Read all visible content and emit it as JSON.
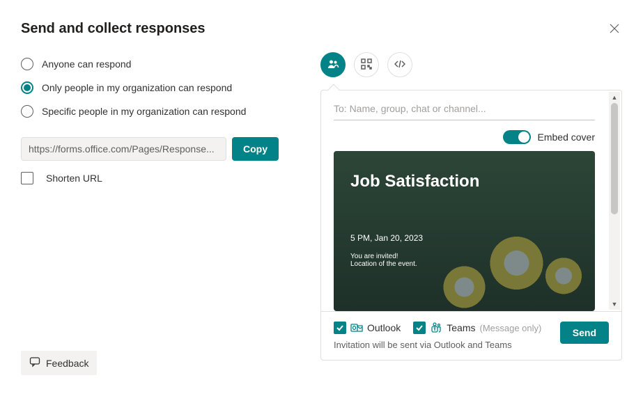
{
  "title": "Send and collect responses",
  "radios": {
    "opt0": "Anyone can respond",
    "opt1": "Only people in my organization can respond",
    "opt2": "Specific people in my organization can respond",
    "selected": 1
  },
  "url": {
    "value": "https://forms.office.com/Pages/Response...",
    "copy_label": "Copy"
  },
  "shorten": {
    "label": "Shorten URL",
    "checked": false
  },
  "feedback_label": "Feedback",
  "tabs": {
    "active": 0
  },
  "invite": {
    "to_placeholder": "To: Name, group, chat or channel...",
    "embed_label": "Embed cover",
    "embed_on": true
  },
  "cover": {
    "title": "Job Satisfaction",
    "time": "5 PM, Jan 20, 2023",
    "line1": "You are invited!",
    "line2": "Location of the event."
  },
  "footer": {
    "outlook_label": "Outlook",
    "outlook_checked": true,
    "teams_label": "Teams",
    "teams_checked": true,
    "teams_note": "(Message only)",
    "note": "Invitation will be sent via Outlook and Teams",
    "send_label": "Send"
  }
}
